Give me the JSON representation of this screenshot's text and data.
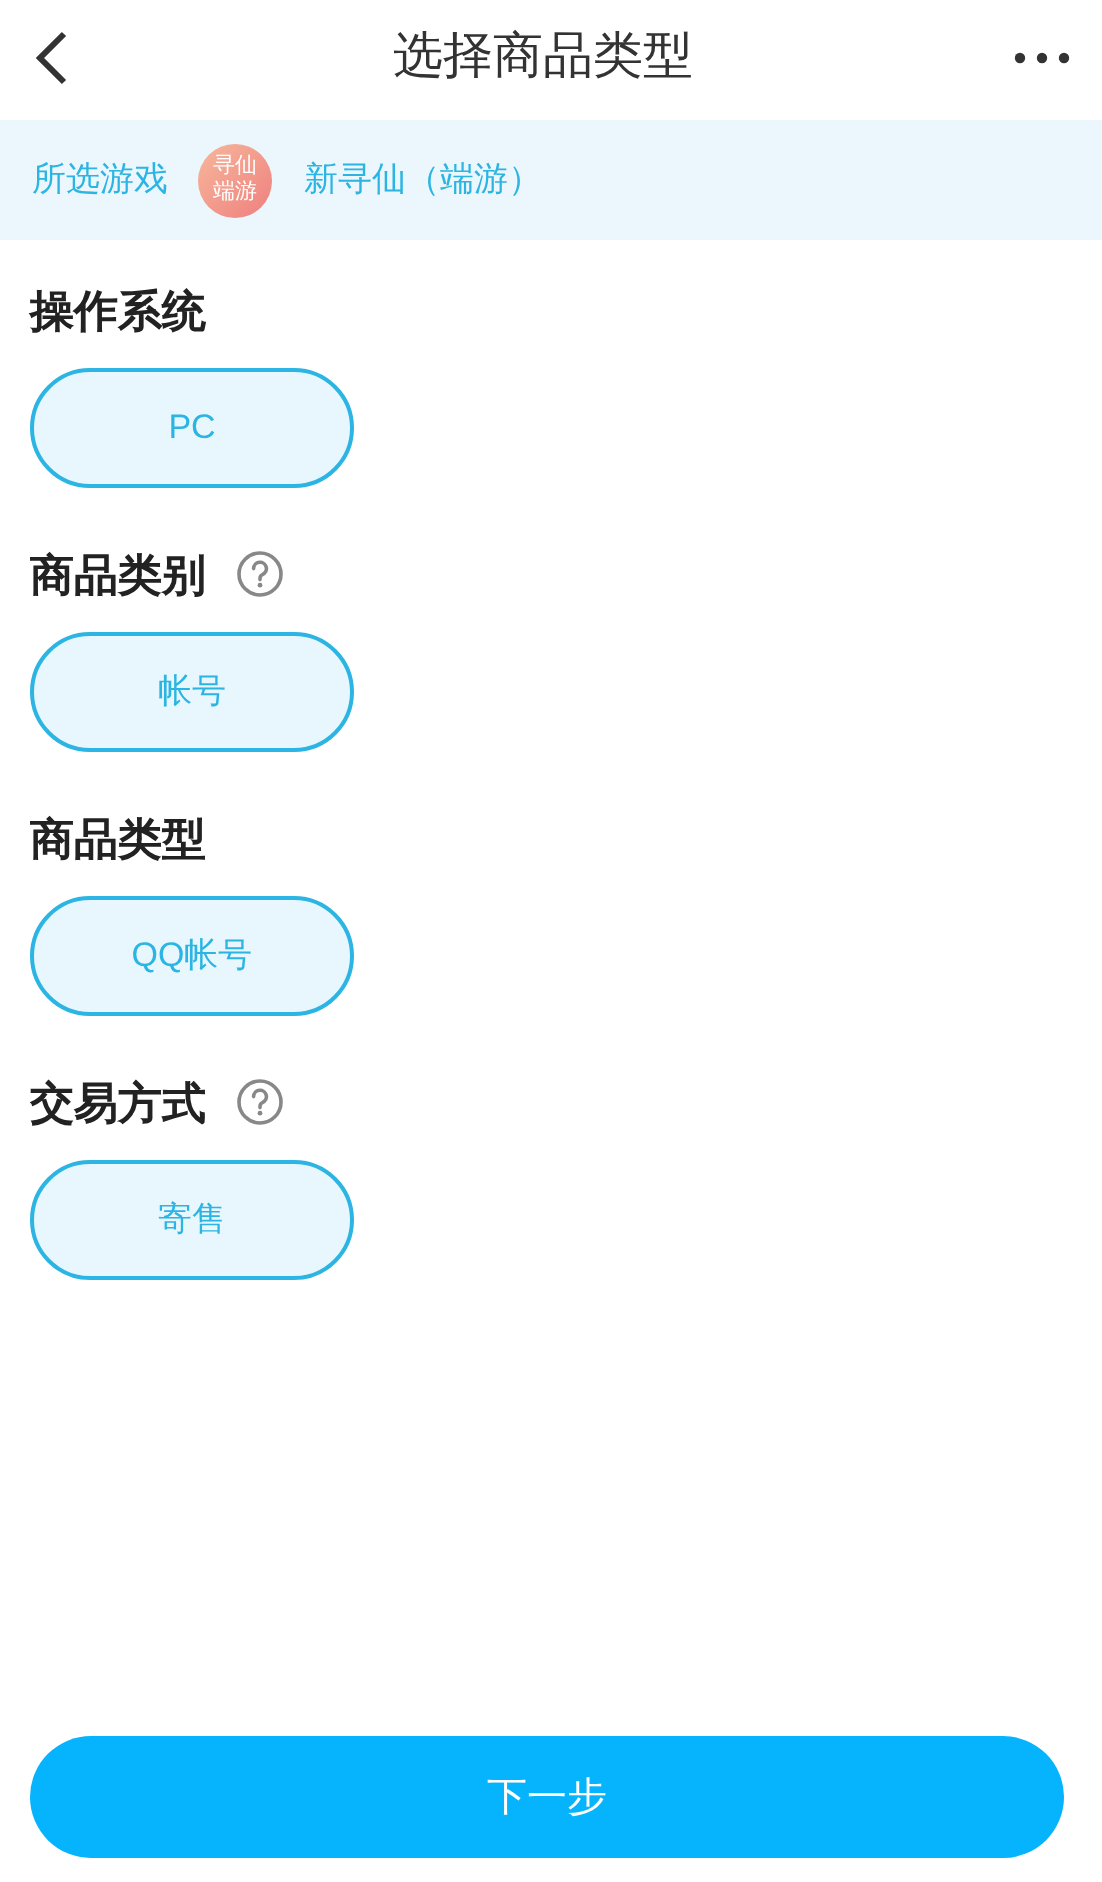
{
  "header": {
    "title": "选择商品类型"
  },
  "game": {
    "label": "所选游戏",
    "logo_lines": [
      "寻仙",
      "端游"
    ],
    "name": "新寻仙（端游）"
  },
  "sections": [
    {
      "title": "操作系统",
      "help": false,
      "options": [
        {
          "label": "PC",
          "selected": true
        }
      ]
    },
    {
      "title": "商品类别",
      "help": true,
      "options": [
        {
          "label": "帐号",
          "selected": true
        }
      ]
    },
    {
      "title": "商品类型",
      "help": false,
      "options": [
        {
          "label": "QQ帐号",
          "selected": true
        }
      ]
    },
    {
      "title": "交易方式",
      "help": true,
      "options": [
        {
          "label": "寄售",
          "selected": true
        }
      ]
    }
  ],
  "next_button": "下一步"
}
